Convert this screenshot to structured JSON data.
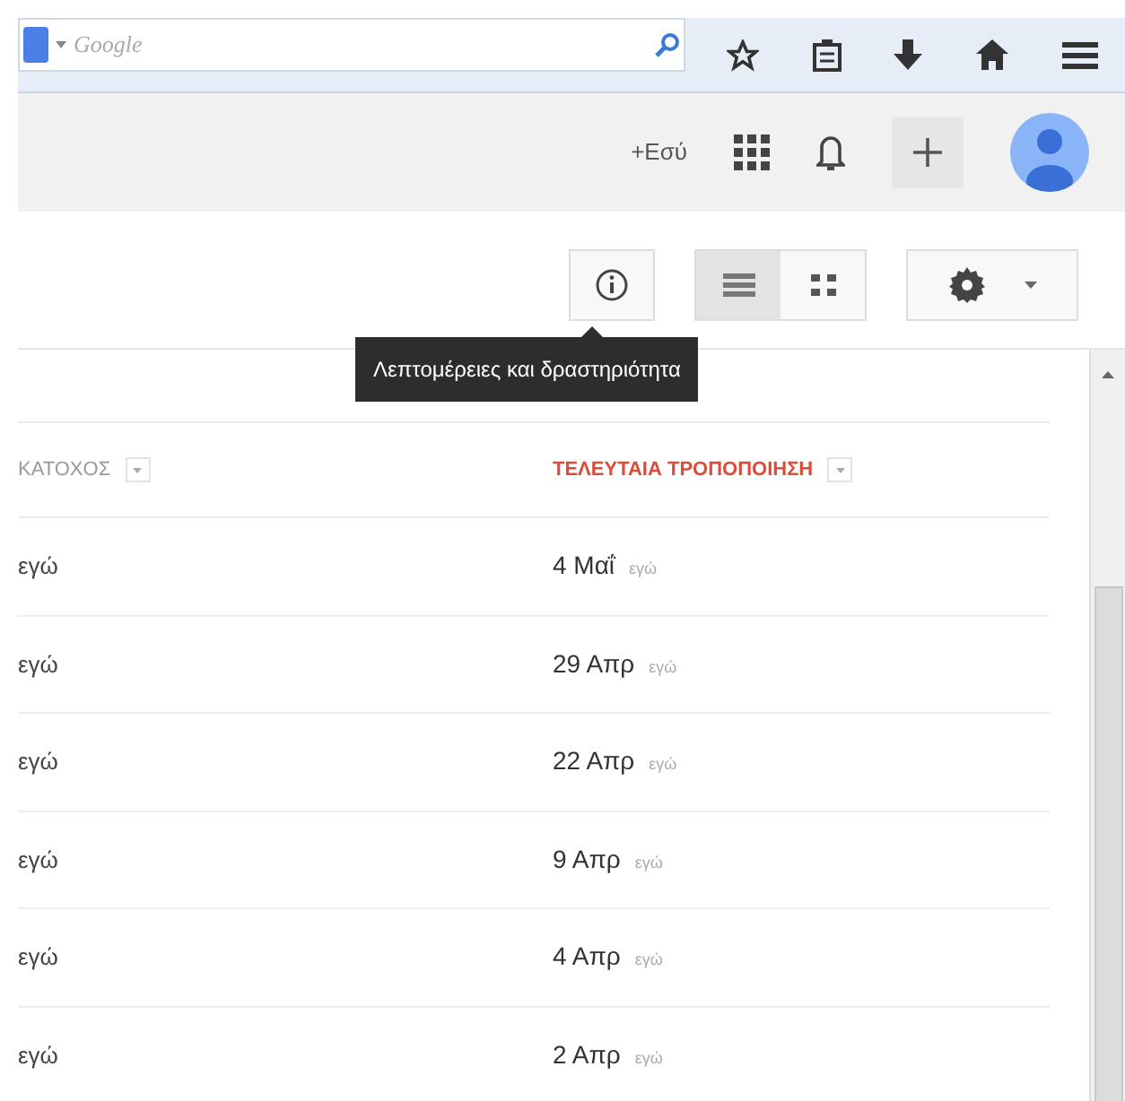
{
  "browser_toolbar": {
    "search": {
      "placeholder": "Google"
    }
  },
  "google_bar": {
    "plus_link": "+Εσύ"
  },
  "toolbar": {
    "view_toggle": [
      {
        "kind": "list",
        "selected": true
      },
      {
        "kind": "grid",
        "selected": false
      }
    ],
    "tooltip": "Λεπτομέρειες και δραστηριότητα"
  },
  "table": {
    "columns": [
      {
        "label": "ΚΑΤΟΧΟΣ",
        "selected": false
      },
      {
        "label": "ΤΕΛΕΥΤΑΙΑ ΤΡΟΠΟΠΟΙΗΣΗ",
        "selected": true
      }
    ],
    "rows": [
      {
        "owner": "εγώ",
        "modified": "4 Μαΐ",
        "modified_by": "εγώ"
      },
      {
        "owner": "εγώ",
        "modified": "29 Απρ",
        "modified_by": "εγώ"
      },
      {
        "owner": "εγώ",
        "modified": "22 Απρ",
        "modified_by": "εγώ"
      },
      {
        "owner": "εγώ",
        "modified": "9 Απρ",
        "modified_by": "εγώ"
      },
      {
        "owner": "εγώ",
        "modified": "4 Απρ",
        "modified_by": "εγώ"
      },
      {
        "owner": "εγώ",
        "modified": "2 Απρ",
        "modified_by": "εγώ"
      }
    ]
  }
}
